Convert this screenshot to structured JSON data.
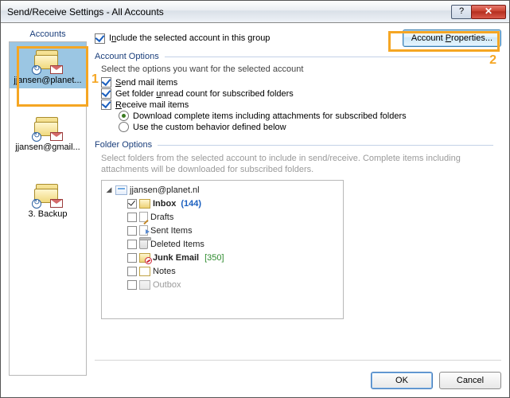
{
  "window": {
    "title": "Send/Receive Settings - All Accounts"
  },
  "sidebar": {
    "header": "Accounts",
    "items": [
      {
        "label": "jjansen@planet..."
      },
      {
        "label": "jjansen@gmail..."
      },
      {
        "label": "3. Backup"
      }
    ]
  },
  "top": {
    "include_label_pre": "Include the selected account in this group",
    "include_underline": "n",
    "account_properties": "Account Properties...",
    "account_properties_underline": "P"
  },
  "annotations": {
    "one": "1",
    "two": "2"
  },
  "account_options": {
    "title": "Account Options",
    "desc": "Select the options you want for the selected account",
    "send_pre": "Send mail items",
    "send_u": "S",
    "unread_pre": "Get folder unread count for subscribed folders",
    "unread_u": "u",
    "receive_pre": "Receive mail items",
    "receive_u": "R",
    "download_full": "Download complete items including attachments for subscribed folders",
    "custom_full": "Use the custom behavior defined below"
  },
  "folder_options": {
    "title": "Folder Options",
    "desc": "Select folders from the selected account to include in send/receive. Complete items including attachments will be downloaded for subscribed folders.",
    "root": "jjansen@planet.nl",
    "items": [
      {
        "name": "Inbox",
        "count": "(144)",
        "checked": true,
        "bold": true,
        "icon": "folder",
        "count_style": "blue"
      },
      {
        "name": "Drafts",
        "checked": false,
        "icon": "draft"
      },
      {
        "name": "Sent Items",
        "checked": false,
        "icon": "sent"
      },
      {
        "name": "Deleted Items",
        "checked": false,
        "icon": "trash"
      },
      {
        "name": "Junk Email",
        "count": "[350]",
        "checked": false,
        "bold": true,
        "icon": "junk",
        "count_style": "green"
      },
      {
        "name": "Notes",
        "checked": false,
        "icon": "note"
      },
      {
        "name": "Outbox",
        "checked": false,
        "icon": "out",
        "disabled": true
      }
    ]
  },
  "buttons": {
    "ok": "OK",
    "cancel": "Cancel"
  }
}
